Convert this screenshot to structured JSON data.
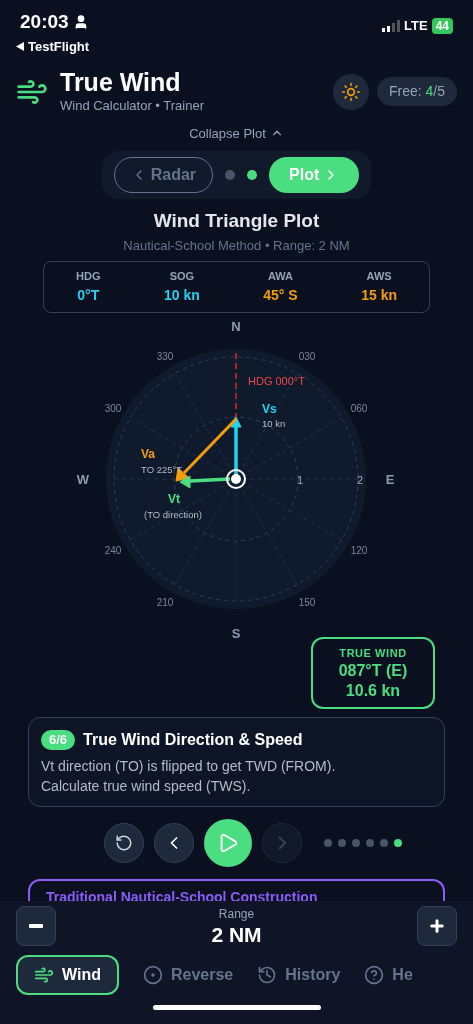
{
  "status_bar": {
    "time": "20:03",
    "back_label": "TestFlight",
    "network": "LTE",
    "battery": "44"
  },
  "header": {
    "title": "True Wind",
    "subtitle": "Wind Calculator • Trainer",
    "free_label": "Free: ",
    "free_used": "4",
    "free_total": "/5"
  },
  "collapse_label": "Collapse Plot",
  "view_switch": {
    "prev": "Radar",
    "next": "Plot",
    "pages": [
      {
        "selected": false
      },
      {
        "selected": true
      }
    ]
  },
  "plot": {
    "title": "Wind Triangle Plot",
    "subtitle": "Nautical-School Method • Range: 2 NM",
    "readouts": [
      {
        "label": "HDG",
        "value": "0°T",
        "color": "#22d3ee"
      },
      {
        "label": "SOG",
        "value": "10 kn",
        "color": "#22d3ee"
      },
      {
        "label": "AWA",
        "value": "45° S",
        "color": "#f59e0b"
      },
      {
        "label": "AWS",
        "value": "15 kn",
        "color": "#f59e0b"
      }
    ],
    "compass": {
      "cardinals": [
        "N",
        "E",
        "S",
        "W"
      ],
      "bearings": [
        "030",
        "060",
        "120",
        "150",
        "210",
        "240",
        "300",
        "330"
      ],
      "rings": [
        "1",
        "2"
      ],
      "heading_label": "HDG 000°T",
      "vectors": [
        {
          "kind": "vs",
          "label": "Vs",
          "note": "10 kn",
          "color": "#22d3ee"
        },
        {
          "kind": "va",
          "label": "Va",
          "note": "TO 225°T",
          "color": "#f59e0b"
        },
        {
          "kind": "vt",
          "label": "Vt",
          "note": "(TO direction)",
          "color": "#4ade80"
        }
      ]
    },
    "true_wind": {
      "label": "TRUE WIND",
      "direction": "087°T (E)",
      "speed": "10.6 kn"
    }
  },
  "step": {
    "badge": "6/6",
    "title": "True Wind Direction & Speed",
    "text": "Vt direction (TO) is flipped to get TWD (FROM). Calculate true wind speed (TWS).",
    "next_disabled": true,
    "dots": [
      {
        "selected": false
      },
      {
        "selected": false
      },
      {
        "selected": false
      },
      {
        "selected": false
      },
      {
        "selected": false
      },
      {
        "selected": true
      }
    ]
  },
  "next_card": {
    "title": "Traditional Nautical-School Construction"
  },
  "range": {
    "label": "Range",
    "value": "2 NM"
  },
  "tabs": [
    {
      "kind": "wind",
      "label": "Wind",
      "selected": true
    },
    {
      "kind": "reverse",
      "label": "Reverse",
      "selected": false
    },
    {
      "kind": "history",
      "label": "History",
      "selected": false
    },
    {
      "kind": "help",
      "label": "He",
      "selected": false
    }
  ]
}
